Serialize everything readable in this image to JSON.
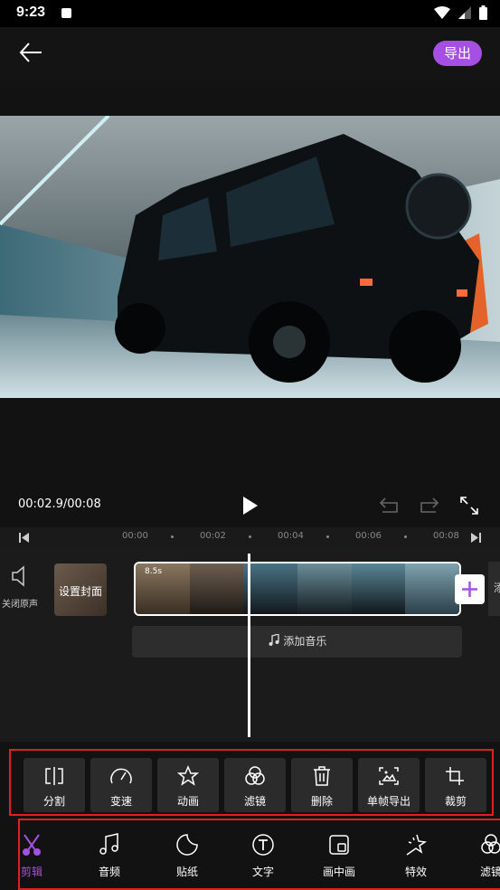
{
  "status_bar": {
    "time": "9:23"
  },
  "header": {
    "export_label": "导出"
  },
  "player": {
    "timecode": "00:02.9/00:08"
  },
  "ruler": {
    "ticks": [
      "00:00",
      "00:02",
      "00:04",
      "00:06",
      "00:08"
    ]
  },
  "timeline": {
    "mute_label": "关闭原声",
    "cover_label": "设置封面",
    "clip_duration": "8.5s",
    "add_music_label": "添加音乐",
    "edge_label": "添"
  },
  "tools": [
    {
      "label": "分割",
      "icon": "split-icon"
    },
    {
      "label": "变速",
      "icon": "speed-icon"
    },
    {
      "label": "动画",
      "icon": "animation-icon"
    },
    {
      "label": "滤镜",
      "icon": "filter-icon"
    },
    {
      "label": "删除",
      "icon": "delete-icon"
    },
    {
      "label": "单帧导出",
      "icon": "frame-export-icon"
    },
    {
      "label": "裁剪",
      "icon": "crop-icon"
    }
  ],
  "tabs": [
    {
      "label": "剪辑",
      "icon": "scissors-icon",
      "active": true
    },
    {
      "label": "音频",
      "icon": "music-icon"
    },
    {
      "label": "贴纸",
      "icon": "sticker-icon"
    },
    {
      "label": "文字",
      "icon": "text-icon"
    },
    {
      "label": "画中画",
      "icon": "pip-icon"
    },
    {
      "label": "特效",
      "icon": "effects-icon"
    },
    {
      "label": "滤镜",
      "icon": "filter-icon"
    }
  ],
  "colors": {
    "accent": "#a550e3",
    "highlight_box": "#e01f1f",
    "background": "#121212"
  }
}
